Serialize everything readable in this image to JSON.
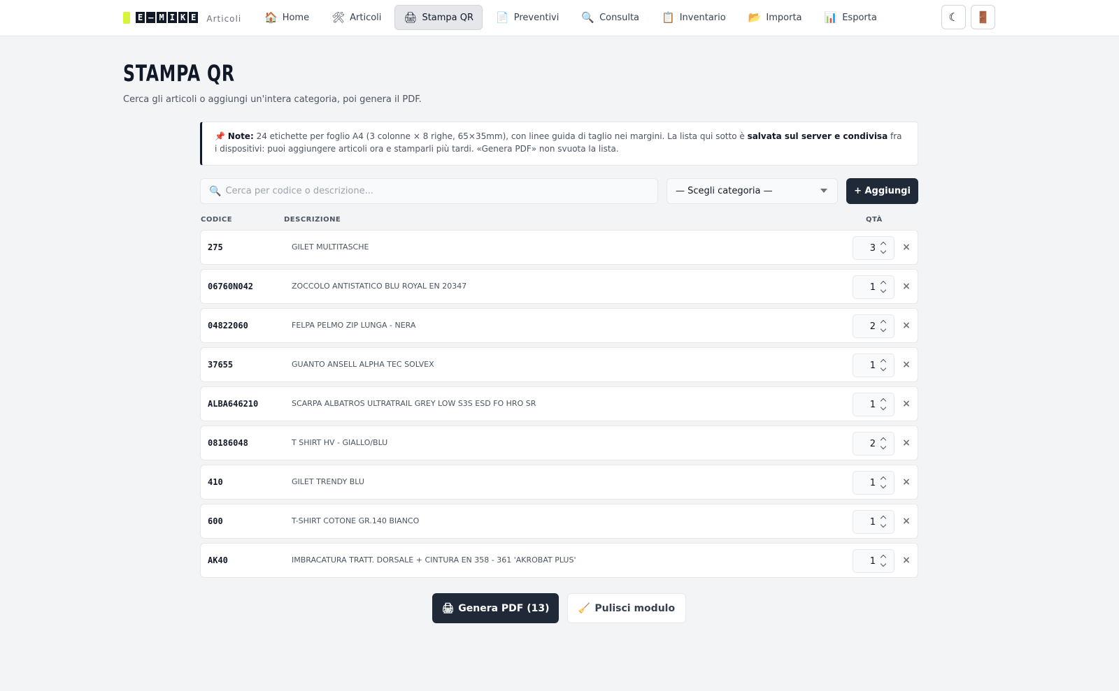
{
  "brand": {
    "logo_letters": [
      "E",
      "–",
      "M",
      "I",
      "K",
      "E"
    ],
    "section": "Articoli",
    "accent_color": "#d7f43a"
  },
  "nav": [
    {
      "label": "Home",
      "icon": "🏠",
      "name": "home",
      "active": false
    },
    {
      "label": "Articoli",
      "icon": "🛠",
      "name": "articoli",
      "active": false
    },
    {
      "label": "Stampa QR",
      "icon": "🖨",
      "name": "stampa-qr",
      "active": true
    },
    {
      "label": "Preventivi",
      "icon": "📄",
      "name": "preventivi",
      "active": false
    },
    {
      "label": "Consulta",
      "icon": "🔍",
      "name": "consulta",
      "active": false
    },
    {
      "label": "Inventario",
      "icon": "📋",
      "name": "inventario",
      "active": false
    },
    {
      "label": "Importa",
      "icon": "📂",
      "name": "importa",
      "active": false
    },
    {
      "label": "Esporta",
      "icon": "📊",
      "name": "esporta",
      "active": false
    }
  ],
  "header_actions": {
    "theme_icon": "☾",
    "logout_icon": "🚪"
  },
  "page": {
    "title": "STAMPA QR",
    "subtitle": "Cerca gli articoli o aggiungi un'intera categoria, poi genera il PDF."
  },
  "note": {
    "icon": "📌",
    "label": "Note:",
    "text_before": " 24 etichette per foglio A4 (3 colonne × 8 righe, 65×35mm), con linee guida di taglio nei margini. La lista qui sotto è ",
    "bold": "salvata sul server e condivisa",
    "text_after": " fra i dispositivi: puoi aggiungere articoli ora e stamparli più tardi. «Genera PDF» non svuota la lista."
  },
  "toolbar": {
    "search_icon": "🔍",
    "search_placeholder": "Cerca per codice o descrizione...",
    "search_value": "",
    "category_selected": "— Scegli categoria —",
    "add_label": "+ Aggiungi"
  },
  "table": {
    "headers": {
      "code": "CODICE",
      "desc": "DESCRIZIONE",
      "qty": "QTÀ"
    },
    "remove_glyph": "×",
    "rows": [
      {
        "code": "275",
        "desc": "GILET MULTITASCHE",
        "qty": "3"
      },
      {
        "code": "06760N042",
        "desc": "ZOCCOLO ANTISTATICO BLU ROYAL EN 20347",
        "qty": "1"
      },
      {
        "code": "04822060",
        "desc": "FELPA PELMO ZIP LUNGA - NERA",
        "qty": "2"
      },
      {
        "code": "37655",
        "desc": "GUANTO ANSELL ALPHA TEC SOLVEX",
        "qty": "1"
      },
      {
        "code": "ALBA646210",
        "desc": "SCARPA ALBATROS ULTRATRAIL GREY LOW S3S ESD FO HRO SR",
        "qty": "1"
      },
      {
        "code": "08186048",
        "desc": "T SHIRT HV - GIALLO/BLU",
        "qty": "2"
      },
      {
        "code": "410",
        "desc": "GILET TRENDY BLU",
        "qty": "1"
      },
      {
        "code": "600",
        "desc": "T-SHIRT COTONE GR.140 BIANCO",
        "qty": "1"
      },
      {
        "code": "AK40",
        "desc": "IMBRACATURA TRATT. DORSALE + CINTURA EN 358 - 361 'AKROBAT PLUS'",
        "qty": "1"
      }
    ]
  },
  "footer": {
    "generate_icon": "🖨",
    "generate_label": "Genera PDF (13)",
    "clear_icon": "🧹",
    "clear_label": "Pulisci modulo"
  }
}
